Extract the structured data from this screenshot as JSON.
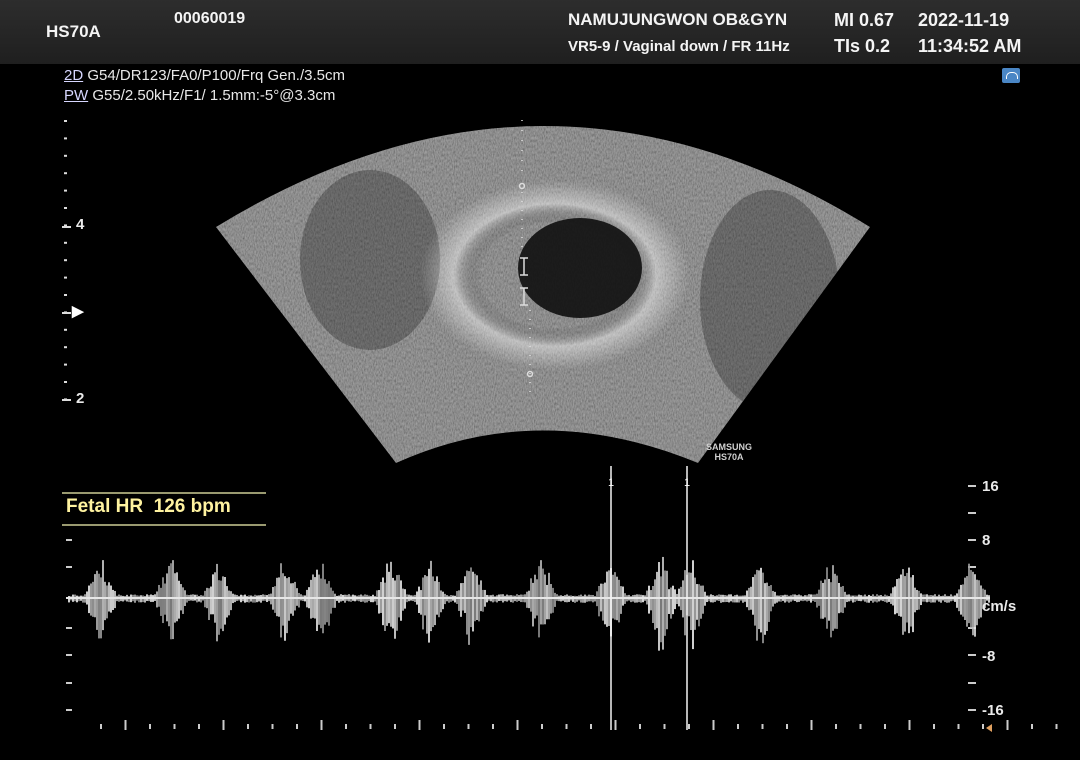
{
  "header": {
    "model": "HS70A",
    "patient_id": "00060019",
    "institution": "NAMUJUNGWON OB&GYN",
    "mi": "MI 0.67",
    "date": "2022-11-19",
    "probe_info": "VR5-9 / Vaginal down / FR 11Hz",
    "tis": "TIs 0.2",
    "time": "11:34:52 AM"
  },
  "params": {
    "mode_2d": "2D",
    "settings_2d": " G54/DR123/FA0/P100/Frq Gen./3.5cm",
    "mode_pw": "PW",
    "settings_pw": " G55/2.50kHz/F1/ 1.5mm:-5°@3.3cm"
  },
  "depth_scale": {
    "labels": [
      "4",
      "2"
    ],
    "focus_marker": "▶"
  },
  "logo": {
    "line1": "SAMSUNG",
    "line2": "HS70A"
  },
  "measurement": {
    "label": "Fetal HR",
    "value": "126 bpm"
  },
  "doppler_scale": {
    "labels": [
      "16",
      "8",
      "cm/s",
      "-8",
      "-16"
    ],
    "unit": "cm/s"
  },
  "calipers": {
    "label_a": "1",
    "label_b": "1"
  },
  "icons": {
    "probe": "probe-icon"
  }
}
